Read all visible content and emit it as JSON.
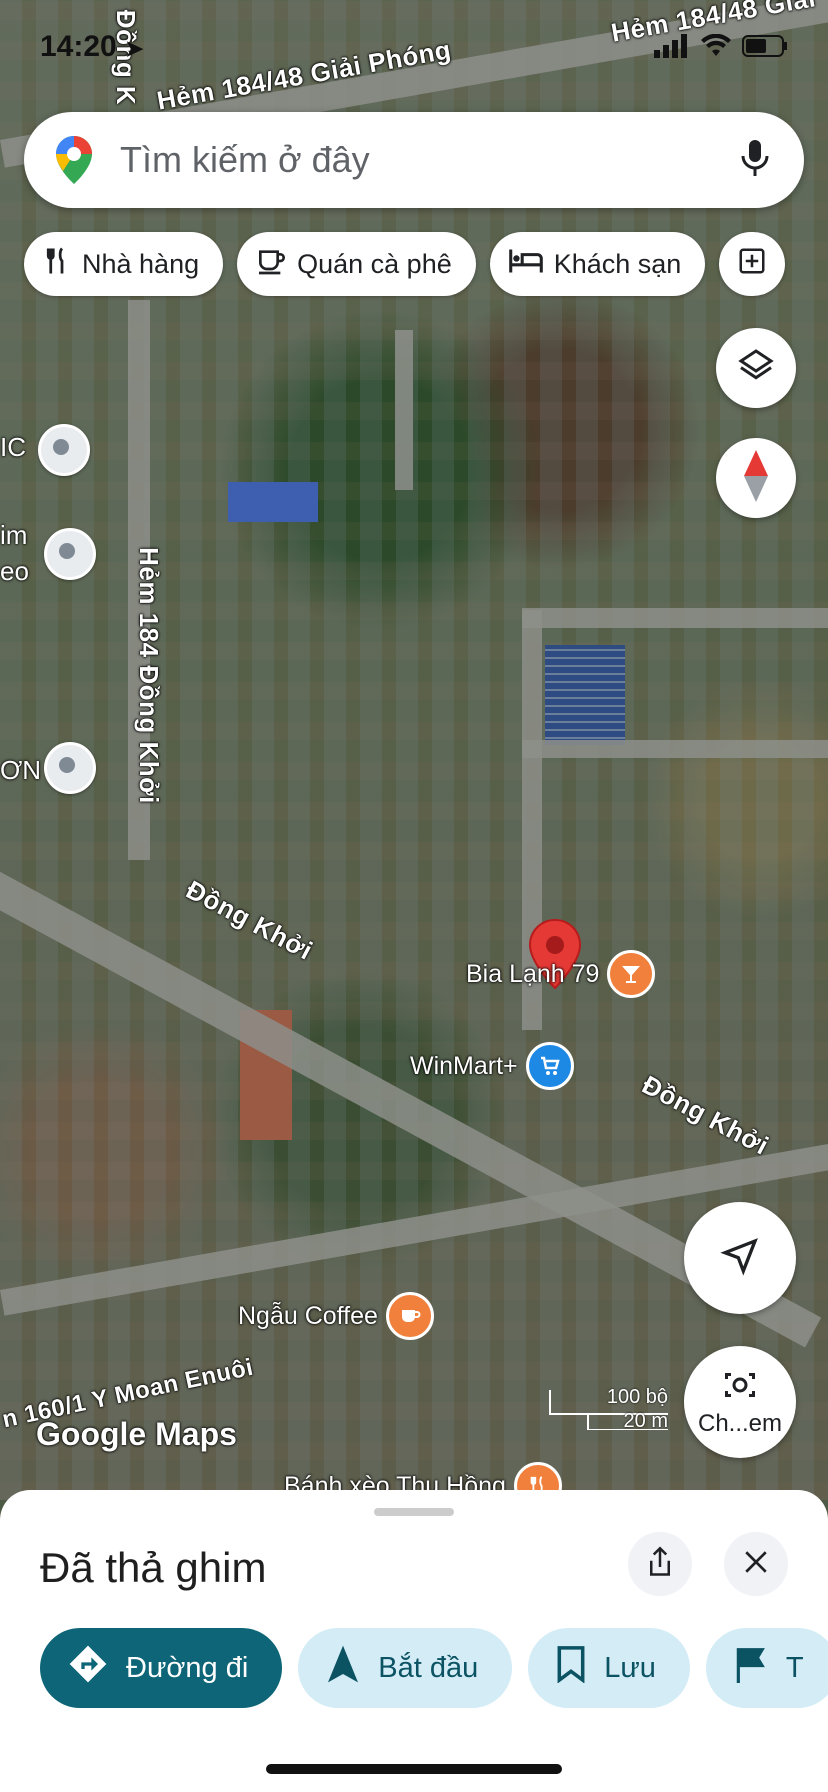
{
  "status_bar": {
    "time": "14:20"
  },
  "search": {
    "placeholder": "Tìm kiếm ở đây"
  },
  "chips": [
    {
      "label": "Nhà hàng",
      "icon": "fork-knife-icon"
    },
    {
      "label": "Quán cà phê",
      "icon": "coffee-cup-icon"
    },
    {
      "label": "Khách sạn",
      "icon": "bed-icon"
    }
  ],
  "map": {
    "streets": {
      "giai_phong_top": "Hẻm 184/48 Giải Phóng",
      "giai_phong_right": "Hẻm 184/48 Giải",
      "hem_184_dong_khoi": "Hẻm 184 Đồng Khởi",
      "dong_khoi_left": "Đồng Khởi",
      "dong_khoi_right": "Đồng Khởi",
      "y_moan": "n 160/1 Y Moan Enuôi",
      "dong_khoi_vertical_top": "Đồng K"
    },
    "pois": {
      "bia_lanh": "Bia Lạnh 79",
      "winmart": "WinMart+",
      "ngau_coffee": "Ngẫu Coffee",
      "banh_xeo": "Bánh xèo Thu Hồng"
    },
    "side_labels": {
      "ic": "IC",
      "im": "im",
      "eo": "eo",
      "on": "ƠN"
    },
    "scale": {
      "feet": "100 bộ",
      "meters": "20 m"
    },
    "logo": "Google Maps",
    "streetview_label": "Ch...em",
    "colors": {
      "pin_red": "#e53935",
      "poi_orange": "#f0803c",
      "poi_blue": "#1e88e5"
    }
  },
  "sheet": {
    "title": "Đã thả ghim",
    "actions": [
      {
        "label": "Đường đi"
      },
      {
        "label": "Bắt đầu"
      },
      {
        "label": "Lưu"
      },
      {
        "label": "T"
      }
    ]
  }
}
